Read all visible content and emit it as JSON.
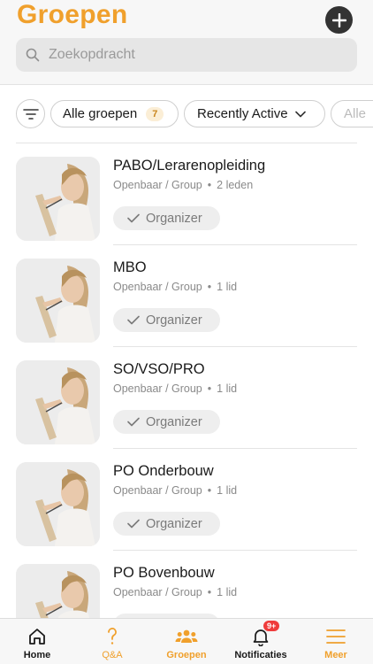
{
  "header": {
    "title": "Groepen",
    "add_icon": "plus-icon",
    "search_placeholder": "Zoekopdracht"
  },
  "filters": {
    "filter_icon": "filter-lines-icon",
    "all_label": "Alle groepen",
    "all_count": "7",
    "sort_label": "Recently Active",
    "more_label": "Alle"
  },
  "groups": [
    {
      "name": "PABO/Lerarenopleiding",
      "visibility": "Openbaar / Group",
      "members": "2 leden",
      "role": "Organizer"
    },
    {
      "name": "MBO",
      "visibility": "Openbaar / Group",
      "members": "1 lid",
      "role": "Organizer"
    },
    {
      "name": "SO/VSO/PRO",
      "visibility": "Openbaar / Group",
      "members": "1 lid",
      "role": "Organizer"
    },
    {
      "name": "PO Onderbouw",
      "visibility": "Openbaar / Group",
      "members": "1 lid",
      "role": "Organizer"
    },
    {
      "name": "PO Bovenbouw",
      "visibility": "Openbaar / Group",
      "members": "1 lid",
      "role": "Organizer"
    }
  ],
  "tabbar": {
    "home": "Home",
    "qa": "Q&A",
    "groups": "Groepen",
    "notifications": "Notificaties",
    "notifications_badge": "9+",
    "more": "Meer"
  },
  "colors": {
    "accent": "#f0a02c",
    "badge": "#ef3b3b"
  }
}
